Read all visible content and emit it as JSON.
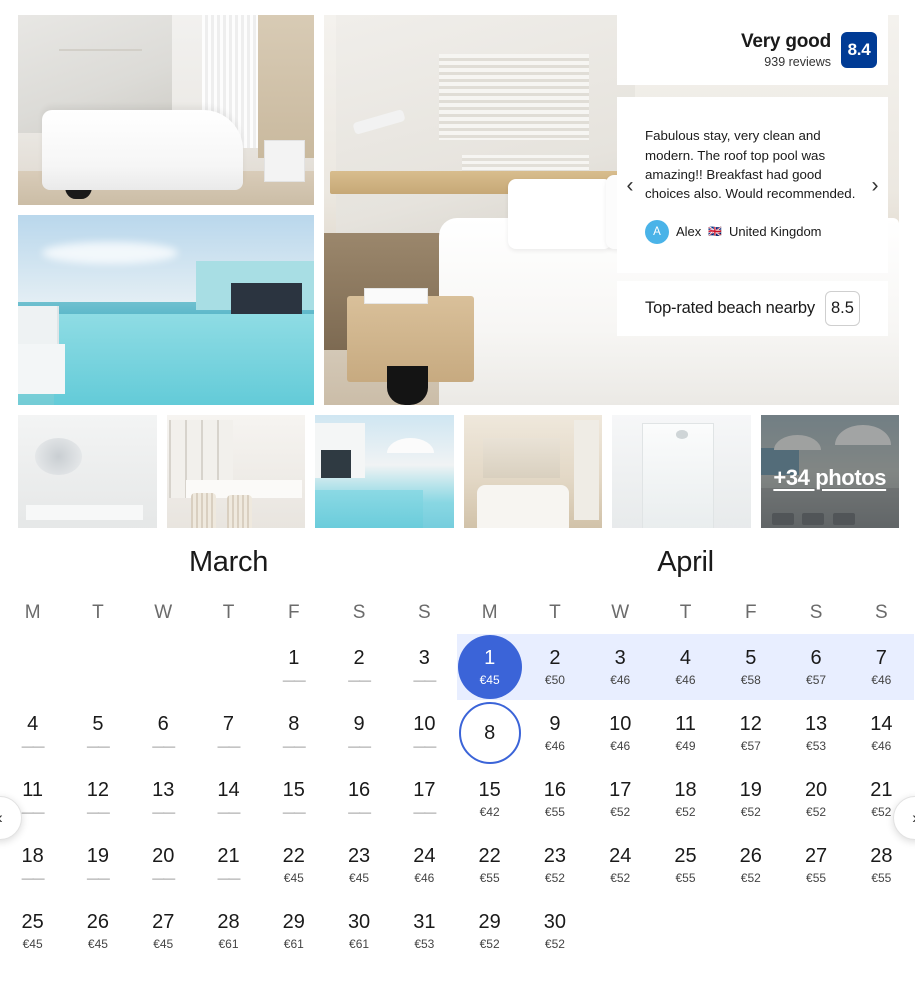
{
  "gallery": {
    "photos": [
      {
        "name": "hotel-room-interior"
      },
      {
        "name": "rooftop-infinity-pool"
      },
      {
        "name": "hero-bedroom"
      }
    ],
    "thumbnails": [
      {
        "name": "bathroom-thumbnail"
      },
      {
        "name": "terrace-dining-thumbnail"
      },
      {
        "name": "poolside-loungers-thumbnail"
      },
      {
        "name": "bedroom-thumbnail"
      },
      {
        "name": "shower-thumbnail"
      },
      {
        "name": "rooftop-deck-thumbnail"
      }
    ],
    "more_photos_label": "+34 photos"
  },
  "rating": {
    "title": "Very good",
    "reviews": "939 reviews",
    "score": "8.4",
    "badge_color": "#003b95"
  },
  "review": {
    "text": "Fabulous stay, very clean and modern. The roof top pool was amazing!! Breakfast had good choices also. Would recommended.",
    "author_initial": "A",
    "author_name": "Alex",
    "author_flag": "🇬🇧",
    "author_country": "United Kingdom",
    "prev_icon": "‹",
    "next_icon": "›"
  },
  "beach": {
    "label": "Top-rated beach nearby",
    "score": "8.5"
  },
  "calendar": {
    "accent_color": "#3b64d8",
    "range_band_color": "#e8eeff",
    "prev_icon": "‹",
    "next_icon": "›",
    "dow": [
      "M",
      "T",
      "W",
      "T",
      "F",
      "S",
      "S"
    ],
    "unavailable_mark": "——",
    "months": [
      {
        "name": "March",
        "weeks": [
          [
            {
              "empty": true
            },
            {
              "empty": true
            },
            {
              "empty": true
            },
            {
              "empty": true
            },
            {
              "day": "1",
              "price": null
            },
            {
              "day": "2",
              "price": null
            },
            {
              "day": "3",
              "price": null
            }
          ],
          [
            {
              "day": "4",
              "price": null
            },
            {
              "day": "5",
              "price": null
            },
            {
              "day": "6",
              "price": null
            },
            {
              "day": "7",
              "price": null
            },
            {
              "day": "8",
              "price": null
            },
            {
              "day": "9",
              "price": null
            },
            {
              "day": "10",
              "price": null
            }
          ],
          [
            {
              "day": "11",
              "price": null
            },
            {
              "day": "12",
              "price": null
            },
            {
              "day": "13",
              "price": null
            },
            {
              "day": "14",
              "price": null
            },
            {
              "day": "15",
              "price": null
            },
            {
              "day": "16",
              "price": null
            },
            {
              "day": "17",
              "price": null
            }
          ],
          [
            {
              "day": "18",
              "price": null
            },
            {
              "day": "19",
              "price": null
            },
            {
              "day": "20",
              "price": null
            },
            {
              "day": "21",
              "price": null
            },
            {
              "day": "22",
              "price": "€45"
            },
            {
              "day": "23",
              "price": "€45"
            },
            {
              "day": "24",
              "price": "€46"
            }
          ],
          [
            {
              "day": "25",
              "price": "€45"
            },
            {
              "day": "26",
              "price": "€45"
            },
            {
              "day": "27",
              "price": "€45"
            },
            {
              "day": "28",
              "price": "€61"
            },
            {
              "day": "29",
              "price": "€61"
            },
            {
              "day": "30",
              "price": "€61"
            },
            {
              "day": "31",
              "price": "€53"
            }
          ]
        ]
      },
      {
        "name": "April",
        "weeks": [
          [
            {
              "day": "1",
              "price": "€45",
              "selected": true
            },
            {
              "day": "2",
              "price": "€50"
            },
            {
              "day": "3",
              "price": "€46"
            },
            {
              "day": "4",
              "price": "€46"
            },
            {
              "day": "5",
              "price": "€58"
            },
            {
              "day": "6",
              "price": "€57"
            },
            {
              "day": "7",
              "price": "€46"
            }
          ],
          [
            {
              "day": "8",
              "price": null,
              "outlined": true
            },
            {
              "day": "9",
              "price": "€46"
            },
            {
              "day": "10",
              "price": "€46"
            },
            {
              "day": "11",
              "price": "€49"
            },
            {
              "day": "12",
              "price": "€57"
            },
            {
              "day": "13",
              "price": "€53"
            },
            {
              "day": "14",
              "price": "€46"
            }
          ],
          [
            {
              "day": "15",
              "price": "€42"
            },
            {
              "day": "16",
              "price": "€55"
            },
            {
              "day": "17",
              "price": "€52"
            },
            {
              "day": "18",
              "price": "€52"
            },
            {
              "day": "19",
              "price": "€52"
            },
            {
              "day": "20",
              "price": "€52"
            },
            {
              "day": "21",
              "price": "€52"
            }
          ],
          [
            {
              "day": "22",
              "price": "€55"
            },
            {
              "day": "23",
              "price": "€52"
            },
            {
              "day": "24",
              "price": "€52"
            },
            {
              "day": "25",
              "price": "€55"
            },
            {
              "day": "26",
              "price": "€52"
            },
            {
              "day": "27",
              "price": "€55"
            },
            {
              "day": "28",
              "price": "€55"
            }
          ],
          [
            {
              "day": "29",
              "price": "€52"
            },
            {
              "day": "30",
              "price": "€52"
            },
            {
              "empty": true
            },
            {
              "empty": true
            },
            {
              "empty": true
            },
            {
              "empty": true
            },
            {
              "empty": true
            }
          ]
        ]
      }
    ]
  }
}
